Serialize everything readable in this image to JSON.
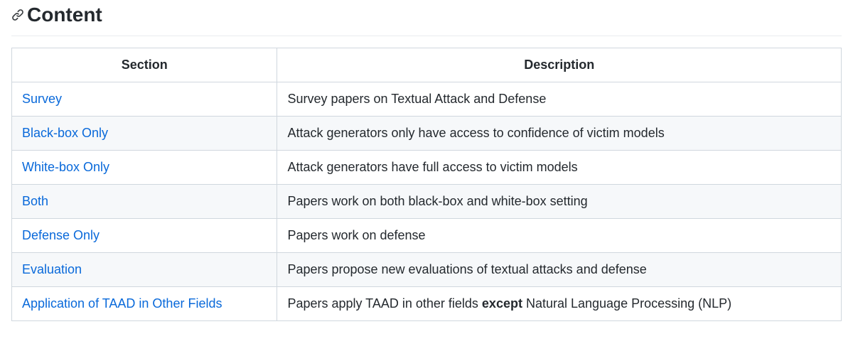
{
  "heading": "Content",
  "table": {
    "headers": {
      "section": "Section",
      "description": "Description"
    },
    "rows": [
      {
        "section": "Survey",
        "desc_pre": "Survey papers on Textual Attack and Defense",
        "desc_bold": "",
        "desc_post": ""
      },
      {
        "section": "Black-box Only",
        "desc_pre": "Attack generators only have access to confidence of victim models",
        "desc_bold": "",
        "desc_post": ""
      },
      {
        "section": "White-box Only",
        "desc_pre": "Attack generators have full access to victim models",
        "desc_bold": "",
        "desc_post": ""
      },
      {
        "section": "Both",
        "desc_pre": "Papers work on both black-box and white-box setting",
        "desc_bold": "",
        "desc_post": ""
      },
      {
        "section": "Defense Only",
        "desc_pre": "Papers work on defense",
        "desc_bold": "",
        "desc_post": ""
      },
      {
        "section": "Evaluation",
        "desc_pre": "Papers propose new evaluations of textual attacks and defense",
        "desc_bold": "",
        "desc_post": ""
      },
      {
        "section": "Application of TAAD in Other Fields",
        "desc_pre": "Papers apply TAAD in other fields ",
        "desc_bold": "except",
        "desc_post": " Natural Language Processing (NLP)"
      }
    ]
  }
}
